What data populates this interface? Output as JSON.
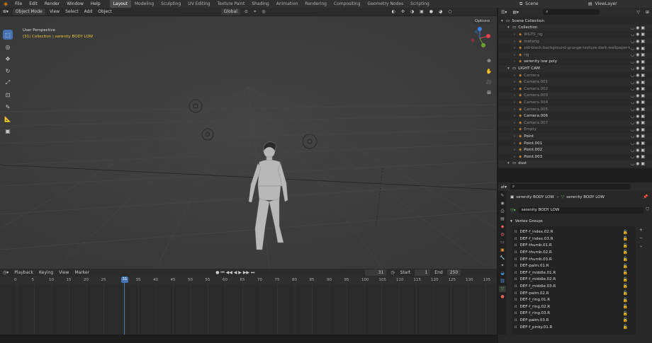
{
  "menu": [
    "File",
    "Edit",
    "Render",
    "Window",
    "Help"
  ],
  "workspaces": [
    "Layout",
    "Modeling",
    "Sculpting",
    "UV Editing",
    "Texture Paint",
    "Shading",
    "Animation",
    "Rendering",
    "Compositing",
    "Geometry Nodes",
    "Scripting"
  ],
  "scene_label": "Scene",
  "view_layer_label": "ViewLayer",
  "viewport": {
    "mode": "Object Mode",
    "menus": [
      "View",
      "Select",
      "Add",
      "Object"
    ],
    "transform": "Global",
    "info_line1": "User Perspective",
    "info_line2": "(31) Collection | serenity BODY LOW",
    "options": "Options"
  },
  "timeline": {
    "menus": [
      "Playback",
      "Keying",
      "View",
      "Marker"
    ],
    "current_frame": "31",
    "start_label": "Start",
    "start": "1",
    "end_label": "End",
    "end": "250",
    "ticks": [
      "0",
      "5",
      "10",
      "15",
      "20",
      "25",
      "31",
      "35",
      "40",
      "45",
      "50",
      "55",
      "60",
      "65",
      "70",
      "75",
      "80",
      "85",
      "90",
      "95",
      "100",
      "105",
      "110",
      "115",
      "120",
      "125",
      "130",
      "135"
    ]
  },
  "outliner": {
    "rows": [
      {
        "label": "Scene Collection",
        "indent": 0,
        "color": "#ddd"
      },
      {
        "label": "Collection",
        "indent": 1,
        "color": "#ddd"
      },
      {
        "label": "WGTS_rig",
        "indent": 2,
        "color": "#888"
      },
      {
        "label": "metarig",
        "indent": 2,
        "color": "#888"
      },
      {
        "label": "old-black-background-grunge-texture-dark-wallpaper-bla",
        "indent": 2,
        "color": "#888"
      },
      {
        "label": "rig",
        "indent": 2,
        "color": "#888"
      },
      {
        "label": "serenity low poly",
        "indent": 2,
        "color": "#ddd"
      },
      {
        "label": "LIGHT CAM",
        "indent": 1,
        "color": "#ddd"
      },
      {
        "label": "Camera",
        "indent": 2,
        "color": "#888"
      },
      {
        "label": "Camera.001",
        "indent": 2,
        "color": "#888"
      },
      {
        "label": "Camera.002",
        "indent": 2,
        "color": "#888"
      },
      {
        "label": "Camera.003",
        "indent": 2,
        "color": "#888"
      },
      {
        "label": "Camera.004",
        "indent": 2,
        "color": "#888"
      },
      {
        "label": "Camera.005",
        "indent": 2,
        "color": "#888"
      },
      {
        "label": "Camera.006",
        "indent": 2,
        "color": "#ddd"
      },
      {
        "label": "Camera.007",
        "indent": 2,
        "color": "#888"
      },
      {
        "label": "Empty",
        "indent": 2,
        "color": "#888"
      },
      {
        "label": "Point",
        "indent": 2,
        "color": "#ddd"
      },
      {
        "label": "Point.001",
        "indent": 2,
        "color": "#ddd"
      },
      {
        "label": "Point.002",
        "indent": 2,
        "color": "#ddd"
      },
      {
        "label": "Point.003",
        "indent": 2,
        "color": "#ddd"
      },
      {
        "label": "dust",
        "indent": 1,
        "color": "#ddd"
      }
    ]
  },
  "properties": {
    "breadcrumb_object": "serenity BODY LOW",
    "breadcrumb_mesh": "serenity BODY LOW",
    "mesh_name": "serenity BODY LOW",
    "panel_title": "Vertex Groups",
    "vertex_groups": [
      "DEF-f_index.02.R",
      "DEF-f_index.03.R",
      "DEF-thumb.01.R",
      "DEF-thumb.02.R",
      "DEF-thumb.03.R",
      "DEF-palm.01.R",
      "DEF-f_middle.01.R",
      "DEF-f_middle.02.R",
      "DEF-f_middle.03.R",
      "DEF-palm.02.R",
      "DEF-f_ring.01.R",
      "DEF-f_ring.02.R",
      "DEF-f_ring.03.R",
      "DEF-palm.03.R",
      "DEF-f_pinky.01.R"
    ]
  }
}
